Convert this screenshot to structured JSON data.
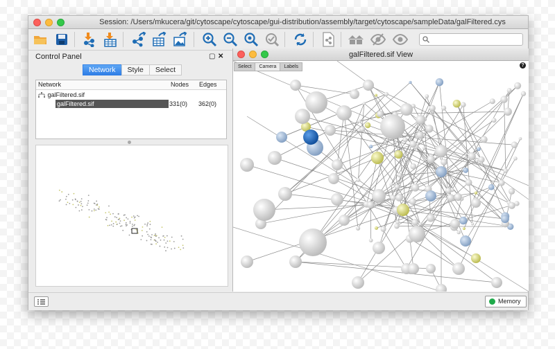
{
  "window": {
    "title": "Session: /Users/mkucera/git/cytoscape/cytoscape/gui-distribution/assembly/target/cytoscape/sampleData/galFiltered.cys"
  },
  "toolbar": {
    "buttons": [
      "open-session",
      "save-session",
      "import-network",
      "import-table",
      "export-network",
      "export-table",
      "export-image",
      "zoom-in",
      "zoom-out",
      "zoom-selected",
      "zoom-fit",
      "refresh",
      "table-snapshot",
      "home",
      "hide",
      "show"
    ],
    "search_placeholder": ""
  },
  "control_panel": {
    "title": "Control Panel",
    "float_glyph": "▢",
    "close_glyph": "✕",
    "tabs": [
      "Network",
      "Style",
      "Select"
    ],
    "active_tab": "Network",
    "table": {
      "headers": [
        "Network",
        "Nodes",
        "Edges"
      ],
      "collection": "galFiltered.sif",
      "rows": [
        {
          "name": "galFiltered.sif",
          "nodes": "331(0)",
          "edges": "362(0)"
        }
      ]
    }
  },
  "network_view": {
    "title": "galFiltered.sif View",
    "modes": [
      "Select",
      "Camera",
      "Labels"
    ],
    "active_mode": "Camera",
    "help_glyph": "?"
  },
  "statusbar": {
    "memory_label": "Memory",
    "memory_status_color": "#1faa4a"
  },
  "colors": {
    "accent": "#2f7ee6",
    "node_selected": "#1565c0",
    "node_yellow": "#dede70",
    "node_blue": "#9fb8d6"
  }
}
